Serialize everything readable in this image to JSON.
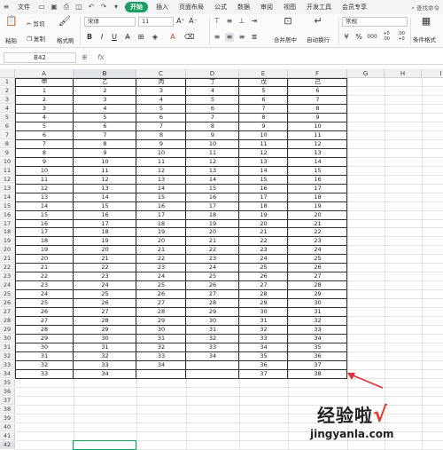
{
  "menu": {
    "items": [
      "文件",
      "开始",
      "插入",
      "页面布局",
      "公式",
      "数据",
      "审阅",
      "视图",
      "开发工具",
      "会员专享"
    ],
    "active": "开始",
    "search_placeholder": "查找命令"
  },
  "ribbon": {
    "paste": "粘贴",
    "cut": "剪切",
    "copy": "复制",
    "format_painter": "格式刷",
    "font_name": "宋体",
    "font_size": "11",
    "bold": "B",
    "italic": "I",
    "underline": "U",
    "merge_center": "合并居中",
    "wrap_text": "自动换行",
    "number_format": "常规",
    "currency": "¥",
    "percent": "%",
    "thousands": "000",
    "inc_decimal": "+0 .00",
    "dec_decimal": ".00 +0",
    "cond_format": "条件格式"
  },
  "formula_bar": {
    "name_box": "B42",
    "fx": "fx",
    "content": ""
  },
  "columns": [
    "A",
    "B",
    "C",
    "D",
    "E",
    "F",
    "G",
    "H",
    "I"
  ],
  "selected_column": "B",
  "selected_row": 42,
  "row_numbers": [
    1,
    2,
    3,
    4,
    5,
    6,
    7,
    8,
    9,
    10,
    11,
    12,
    13,
    14,
    15,
    16,
    17,
    18,
    19,
    20,
    21,
    22,
    23,
    24,
    25,
    26,
    27,
    28,
    29,
    30,
    31,
    32,
    33,
    34,
    35,
    36,
    37,
    38,
    39,
    40,
    41,
    42
  ],
  "headers": [
    "甲",
    "乙",
    "丙",
    "丁",
    "戊",
    "己"
  ],
  "table": [
    [
      "1",
      "2",
      "3",
      "4",
      "5",
      "6"
    ],
    [
      "2",
      "3",
      "4",
      "5",
      "6",
      "7"
    ],
    [
      "3",
      "4",
      "5",
      "6",
      "7",
      "8"
    ],
    [
      "4",
      "5",
      "6",
      "7",
      "8",
      "9"
    ],
    [
      "5",
      "6",
      "7",
      "8",
      "9",
      "10"
    ],
    [
      "6",
      "7",
      "8",
      "9",
      "10",
      "11"
    ],
    [
      "7",
      "8",
      "9",
      "10",
      "11",
      "12"
    ],
    [
      "8",
      "9",
      "10",
      "11",
      "12",
      "13"
    ],
    [
      "9",
      "10",
      "11",
      "12",
      "13",
      "14"
    ],
    [
      "10",
      "11",
      "12",
      "13",
      "14",
      "15"
    ],
    [
      "11",
      "12",
      "13",
      "14",
      "15",
      "16"
    ],
    [
      "12",
      "13",
      "14",
      "15",
      "16",
      "17"
    ],
    [
      "13",
      "14",
      "15",
      "16",
      "17",
      "18"
    ],
    [
      "14",
      "15",
      "16",
      "17",
      "18",
      "19"
    ],
    [
      "15",
      "16",
      "17",
      "18",
      "19",
      "20"
    ],
    [
      "16",
      "17",
      "18",
      "19",
      "20",
      "21"
    ],
    [
      "17",
      "18",
      "19",
      "20",
      "21",
      "22"
    ],
    [
      "18",
      "19",
      "20",
      "21",
      "22",
      "23"
    ],
    [
      "19",
      "20",
      "21",
      "22",
      "23",
      "24"
    ],
    [
      "20",
      "21",
      "22",
      "23",
      "24",
      "25"
    ],
    [
      "21",
      "22",
      "23",
      "24",
      "25",
      "26"
    ],
    [
      "22",
      "23",
      "24",
      "25",
      "26",
      "27"
    ],
    [
      "23",
      "24",
      "25",
      "26",
      "27",
      "28"
    ],
    [
      "24",
      "25",
      "26",
      "27",
      "28",
      "29"
    ],
    [
      "25",
      "26",
      "27",
      "28",
      "29",
      "30"
    ],
    [
      "26",
      "27",
      "28",
      "29",
      "30",
      "31"
    ],
    [
      "27",
      "28",
      "29",
      "30",
      "31",
      "32"
    ],
    [
      "28",
      "29",
      "30",
      "31",
      "32",
      "33"
    ],
    [
      "29",
      "30",
      "31",
      "32",
      "33",
      "34"
    ],
    [
      "30",
      "31",
      "32",
      "33",
      "34",
      "35"
    ],
    [
      "31",
      "32",
      "33",
      "34",
      "35",
      "36"
    ],
    [
      "32",
      "33",
      "34",
      "",
      "36",
      "37"
    ],
    [
      "33",
      "34",
      "",
      "",
      "37",
      "38"
    ]
  ],
  "watermark": {
    "text": "经验啦",
    "check": "√",
    "url": "jingyanla.com"
  },
  "colors": {
    "accent": "#1a9e63",
    "arrow": "#e0303a"
  }
}
